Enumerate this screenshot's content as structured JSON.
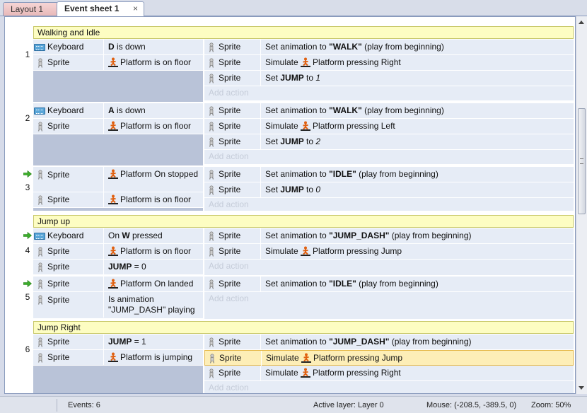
{
  "tabs": [
    {
      "label": "Layout 1"
    },
    {
      "label": "Event sheet 1",
      "close": "×"
    }
  ],
  "groups": [
    {
      "label": "Walking and Idle"
    },
    {
      "label": "Jump up"
    },
    {
      "label": "Jump Right"
    }
  ],
  "events": [
    {
      "num": "1",
      "conditions": [
        {
          "object": "Keyboard",
          "text": "D is down"
        },
        {
          "object": "Sprite",
          "text": "Platform is on floor"
        }
      ],
      "actions": [
        {
          "object": "Sprite",
          "pre": "Set animation to ",
          "bold": "\"WALK\"",
          "post": " (play from beginning)"
        },
        {
          "object": "Sprite",
          "pre": "Simulate ",
          "post": "Platform pressing Right"
        },
        {
          "object": "Sprite",
          "pre": "Set ",
          "bold": "JUMP",
          "post": " to ",
          "ital": "1"
        }
      ]
    },
    {
      "num": "2",
      "conditions": [
        {
          "object": "Keyboard",
          "text": "A is down"
        },
        {
          "object": "Sprite",
          "text": "Platform is on floor"
        }
      ],
      "actions": [
        {
          "object": "Sprite",
          "pre": "Set animation to ",
          "bold": "\"WALK\"",
          "post": " (play from beginning)"
        },
        {
          "object": "Sprite",
          "pre": "Simulate ",
          "post": "Platform pressing Left"
        },
        {
          "object": "Sprite",
          "pre": "Set ",
          "bold": "JUMP",
          "post": " to ",
          "ital": "2"
        }
      ]
    },
    {
      "num": "3",
      "conditions": [
        {
          "object": "Sprite",
          "text": "Platform On stopped"
        },
        {
          "object": "Sprite",
          "text": "Platform is on floor"
        }
      ],
      "actions": [
        {
          "object": "Sprite",
          "pre": "Set animation to ",
          "bold": "\"IDLE\"",
          "post": " (play from beginning)"
        },
        {
          "object": "Sprite",
          "pre": "Set ",
          "bold": "JUMP",
          "post": " to ",
          "ital": "0"
        }
      ]
    },
    {
      "num": "4",
      "conditions": [
        {
          "object": "Keyboard",
          "text": "On W pressed"
        },
        {
          "object": "Sprite",
          "text": "Platform is on floor"
        },
        {
          "object": "Sprite",
          "text": "JUMP = 0"
        }
      ],
      "actions": [
        {
          "object": "Sprite",
          "pre": "Set animation to ",
          "bold": "\"JUMP_DASH\"",
          "post": " (play from beginning)"
        },
        {
          "object": "Sprite",
          "pre": "Simulate ",
          "post": "Platform pressing Jump"
        }
      ]
    },
    {
      "num": "5",
      "conditions": [
        {
          "object": "Sprite",
          "text": "Platform On landed"
        },
        {
          "object": "Sprite",
          "text": "Is animation \"JUMP_DASH\" playing"
        }
      ],
      "actions": [
        {
          "object": "Sprite",
          "pre": "Set animation to ",
          "bold": "\"IDLE\"",
          "post": " (play from beginning)"
        }
      ]
    },
    {
      "num": "6",
      "conditions": [
        {
          "object": "Sprite",
          "text": "JUMP = 1"
        },
        {
          "object": "Sprite",
          "text": "Platform is jumping"
        }
      ],
      "actions": [
        {
          "object": "Sprite",
          "pre": "Set animation to ",
          "bold": "\"JUMP_DASH\"",
          "post": " (play from beginning)"
        },
        {
          "object": "Sprite",
          "pre": "Simulate ",
          "post": "Platform pressing Jump"
        },
        {
          "object": "Sprite",
          "pre": "Simulate ",
          "post": "Platform pressing Right"
        }
      ]
    }
  ],
  "add_action_label": "Add action",
  "status": {
    "events": "Events: 6",
    "active_layer": "Active layer: Layer 0",
    "mouse": "Mouse: (-208.5, -389.5, 0)",
    "zoom": "Zoom: 50%"
  }
}
